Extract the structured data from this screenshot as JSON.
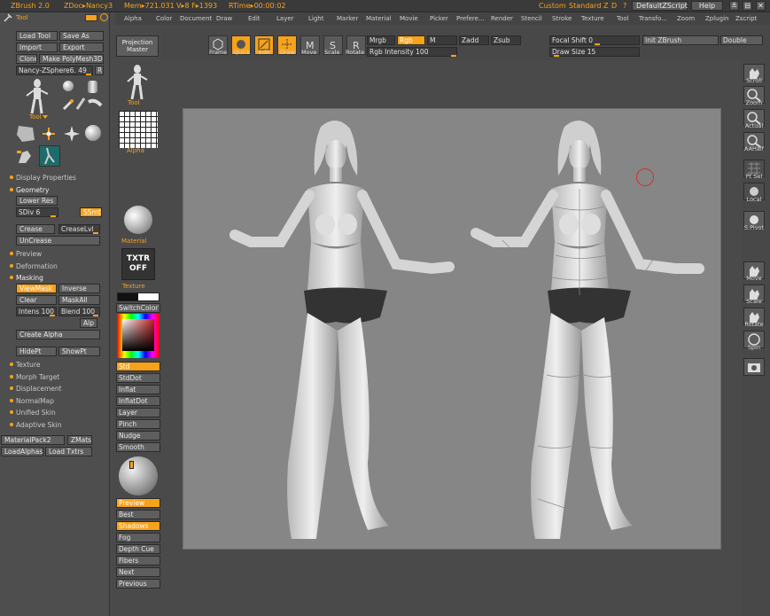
{
  "title_bar": {
    "app": "ZBrush 2.0",
    "doc": "ZDoc▸Nancy3",
    "mem": "Mem▸721.031",
    "vf": "V▸8  F▸1393",
    "rtime": "RTime▸00:00:02",
    "custom": "Custom",
    "standard": "Standard",
    "z": "Z",
    "d": "D",
    "question": "?",
    "script_btn": "DefaultZScript",
    "help_btn": "Help",
    "win_btns": [
      "≚",
      "⊟",
      "✕"
    ]
  },
  "menu": [
    "Alpha",
    "Color",
    "Document",
    "Draw",
    "Edit",
    "Layer",
    "Light",
    "Marker",
    "Material",
    "Movie",
    "Picker",
    "Prefere...",
    "Render",
    "Stencil",
    "Stroke",
    "Texture",
    "Tool",
    "Transfo...",
    "Zoom",
    "Zplugin",
    "Zscript"
  ],
  "tool_panel": {
    "header": "Tool",
    "buttons": {
      "load_tool": "Load Tool",
      "save_as": "Save As",
      "import": "Import",
      "export": "Export",
      "clone": "Clone",
      "make_polymesh": "Make PolyMesh3D",
      "tool_name": "Nancy-ZSphere6. 49",
      "r": "R"
    },
    "tool_label": "Tool",
    "sections": [
      "Display Properties",
      "Geometry"
    ],
    "geometry": {
      "lower_res": "Lower Res",
      "sdiv": "SDiv 6",
      "ssmt": "SSmt",
      "crease": "Crease",
      "creaselvl": "CreaseLvl",
      "uncrease": "UnCrease"
    },
    "sections2": [
      "Preview",
      "Deformation",
      "Masking"
    ],
    "masking": {
      "viewmask": "ViewMask",
      "inverse": "Inverse",
      "clear": "Clear",
      "maskall": "MaskAll",
      "intens": "Intens 100",
      "blend": "Blend 100",
      "alp": "Alp",
      "create_alpha": "Create Alpha",
      "hidept": "HidePt",
      "showpt": "ShowPt"
    },
    "sections3": [
      "Texture",
      "Morph Target",
      "Displacement",
      "NormalMap",
      "Unified Skin",
      "Adaptive Skin"
    ],
    "bottom": {
      "matpack": "MaterialPack2",
      "zmats": "ZMats",
      "loadalphas": "LoadAlphas",
      "loadtxtrs": "Load Txtrs"
    }
  },
  "col2": {
    "projection_master": "Projection Master",
    "tool_lbl": "Tool",
    "alpha_lbl": "Alpha",
    "material_lbl": "Material",
    "texture_lbl": "Texture",
    "txtr": "TXTR",
    "off": "OFF",
    "switchcolor": "SwitchColor",
    "strokes": [
      "Std",
      "StdDot",
      "Inflat",
      "InflatDot",
      "Layer",
      "Pinch",
      "Nudge",
      "Smooth"
    ],
    "render": [
      "Preview",
      "Best",
      "Shadows",
      "Fog",
      "Depth Cue",
      "Fibers",
      "Next",
      "Previous"
    ]
  },
  "toolbar": {
    "tools": [
      "Frame",
      "Quick",
      "Edit",
      "Draw",
      "Move",
      "Scale",
      "Rotate"
    ],
    "mrgb": "Mrgb",
    "rgb": "Rgb",
    "m": "M",
    "zadd": "Zadd",
    "zsub": "Zsub",
    "rgb_intensity": "Rgb Intensity 100",
    "focal_shift": "Focal Shift 0",
    "draw_size": "Draw Size 15",
    "init_zbrush": "Init ZBrush",
    "double": "Double"
  },
  "right_shelf": [
    "Scroll",
    "Zoom",
    "Actual",
    "AAHalf",
    "Pt Sel",
    "Local",
    "S.Pivot",
    "Move",
    "Scale",
    "Rotate",
    "Spin"
  ],
  "colors": {
    "accent": "#f7a21b",
    "panel": "#4e4e4e",
    "canvas": "#868686"
  }
}
